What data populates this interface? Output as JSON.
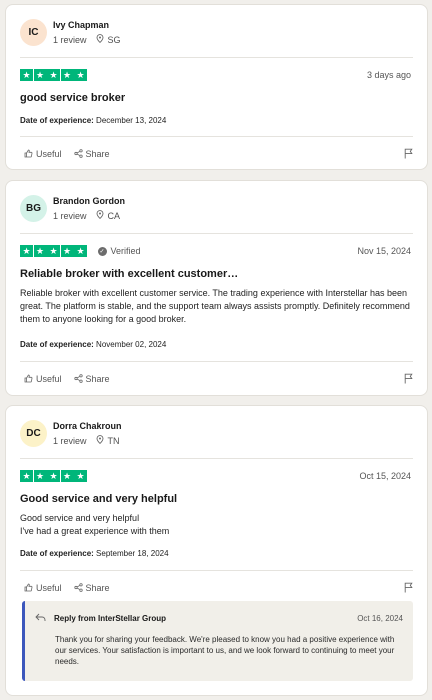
{
  "colors": {
    "star": "#00b67a",
    "reply_border": "#3c57bc"
  },
  "reviews": [
    {
      "initials": "IC",
      "avatar_color": "#fbe3cf",
      "name": "Ivy Chapman",
      "review_count": "1 review",
      "country": "SG",
      "rating": 5,
      "verified": "",
      "date": "3 days ago",
      "title": "good service broker",
      "body": "",
      "experience_label": "Date of experience:",
      "experience_date": "December 13, 2024",
      "useful": "Useful",
      "share": "Share"
    },
    {
      "initials": "BG",
      "avatar_color": "#d4f2e8",
      "name": "Brandon Gordon",
      "review_count": "1 review",
      "country": "CA",
      "rating": 5,
      "verified": "Verified",
      "date": "Nov 15, 2024",
      "title": "Reliable broker with excellent customer…",
      "body": "Reliable broker with excellent customer service. The trading experience with Interstellar has been great. The platform is stable, and the support team always assists promptly. Definitely recommend them to anyone looking for a good broker.",
      "experience_label": "Date of experience:",
      "experience_date": "November 02, 2024",
      "useful": "Useful",
      "share": "Share"
    },
    {
      "initials": "DC",
      "avatar_color": "#fcf2c8",
      "name": "Dorra Chakroun",
      "review_count": "1 review",
      "country": "TN",
      "rating": 5,
      "verified": "",
      "date": "Oct 15, 2024",
      "title": "Good service and very helpful",
      "body_lines": [
        "Good service and very helpful",
        "I've had a great experience with them"
      ],
      "experience_label": "Date of experience:",
      "experience_date": "September 18, 2024",
      "useful": "Useful",
      "share": "Share",
      "reply": {
        "title": "Reply from InterStellar Group",
        "date": "Oct 16, 2024",
        "text": "Thank you for sharing your feedback. We're pleased to know you had a positive experience with our services. Your satisfaction is important to us, and we look forward to continuing to meet your needs."
      }
    }
  ]
}
